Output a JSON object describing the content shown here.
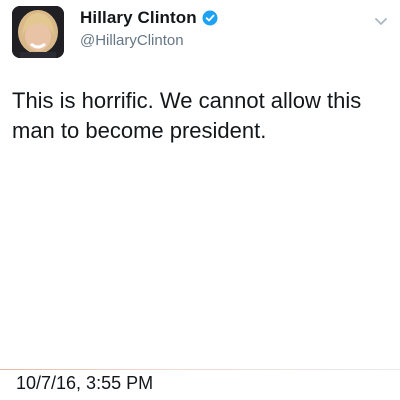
{
  "tweet": {
    "display_name": "Hillary Clinton",
    "handle": "@HillaryClinton",
    "verified": true,
    "text": "This is horrific. We cannot allow this man to become president.",
    "timestamp": "10/7/16, 3:55 PM"
  },
  "icons": {
    "avatar": "avatar-photo",
    "verified": "verified-badge-icon",
    "menu": "chevron-down-icon"
  },
  "colors": {
    "verified_badge": "#1da1f2",
    "text_primary": "#14171a",
    "text_secondary": "#657786"
  }
}
